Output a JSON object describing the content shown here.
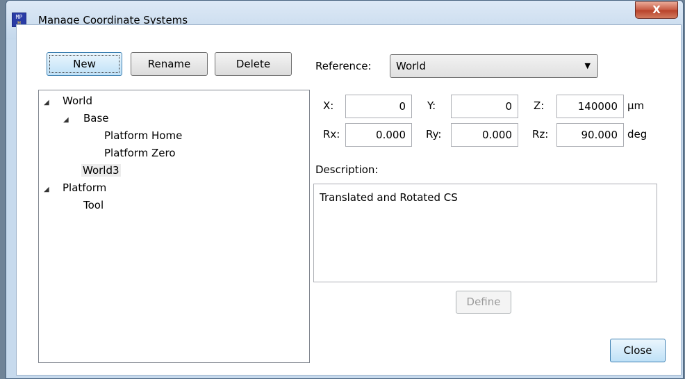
{
  "window": {
    "title": "Manage Coordinate Systems",
    "app_icon_text_top": "MP",
    "app_icon_text_bottom": "H",
    "close_glyph": "X"
  },
  "toolbar": {
    "new_label": "New",
    "rename_label": "Rename",
    "delete_label": "Delete"
  },
  "tree": {
    "world": "World",
    "base": "Base",
    "platform_home": "Platform Home",
    "platform_zero": "Platform Zero",
    "world3": "World3",
    "platform": "Platform",
    "tool": "Tool",
    "expand_glyph": "◢"
  },
  "reference": {
    "label": "Reference:",
    "value": "World",
    "arrow": "▼"
  },
  "coords": {
    "x_label": "X:",
    "x_value": "0",
    "y_label": "Y:",
    "y_value": "0",
    "z_label": "Z:",
    "z_value": "140000",
    "pos_unit": "µm",
    "rx_label": "Rx:",
    "rx_value": "0.000",
    "ry_label": "Ry:",
    "ry_value": "0.000",
    "rz_label": "Rz:",
    "rz_value": "90.000",
    "rot_unit": "deg"
  },
  "description": {
    "label": "Description:",
    "value": "Translated and Rotated CS"
  },
  "actions": {
    "define_label": "Define",
    "close_label": "Close"
  }
}
